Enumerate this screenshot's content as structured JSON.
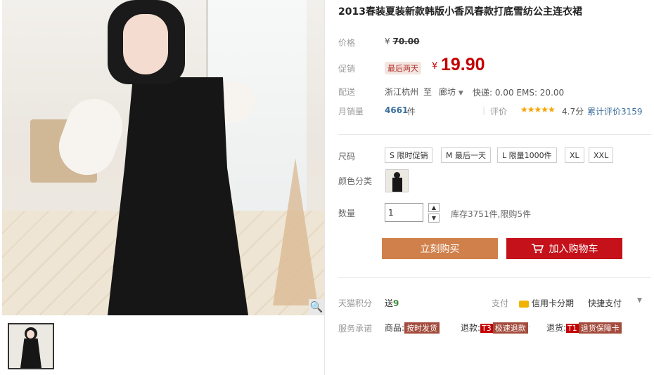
{
  "gallery": {
    "zoom_icon": "magnifier-icon",
    "thumbnails": [
      "thumb-1"
    ]
  },
  "product": {
    "title": "2013春装夏装新款韩版小香风春款打底雪纺公主连衣裙"
  },
  "price": {
    "label": "价格",
    "currency": "¥",
    "original": "70.00",
    "promo_label": "促销",
    "promo_tag": "最后两天",
    "promo_price": "19.90"
  },
  "shipping": {
    "label": "配送",
    "from": "浙江杭州",
    "to_word": "至",
    "destination": "廊坊",
    "fees": "快递: 0.00 EMS: 20.00"
  },
  "sales": {
    "label": "月销量",
    "count": "4661",
    "unit": "件",
    "rating_label": "评价",
    "stars": "★★★★★",
    "rating": "4.7分",
    "total_reviews": "累计评价3159"
  },
  "size": {
    "label": "尺码",
    "options": [
      "S 限时促销",
      "M 最后一天",
      "L 限量1000件",
      "XL",
      "XXL"
    ]
  },
  "color": {
    "label": "颜色分类"
  },
  "quantity": {
    "label": "数量",
    "value": "1",
    "stock": "库存3751件,限购5件"
  },
  "actions": {
    "buy_now": "立刻购买",
    "add_to_cart": "加入购物车"
  },
  "points": {
    "label": "天猫积分",
    "prefix": "送",
    "value": "9",
    "pay_label": "支付",
    "installment": "信用卡分期",
    "quick_pay": "快捷支付"
  },
  "service": {
    "label": "服务承诺",
    "goods_label": "商品:",
    "goods_badge": "按时发货",
    "refund_label": "退款:",
    "refund_code": "T3",
    "refund_badge": "极速退款",
    "return_label": "退货:",
    "return_code": "T1",
    "return_badge": "退货保障卡"
  },
  "colors": {
    "promo_red": "#c40000",
    "buy_orange": "#d0804a",
    "cart_red": "#c4111a",
    "link_blue": "#3c6e9c"
  }
}
